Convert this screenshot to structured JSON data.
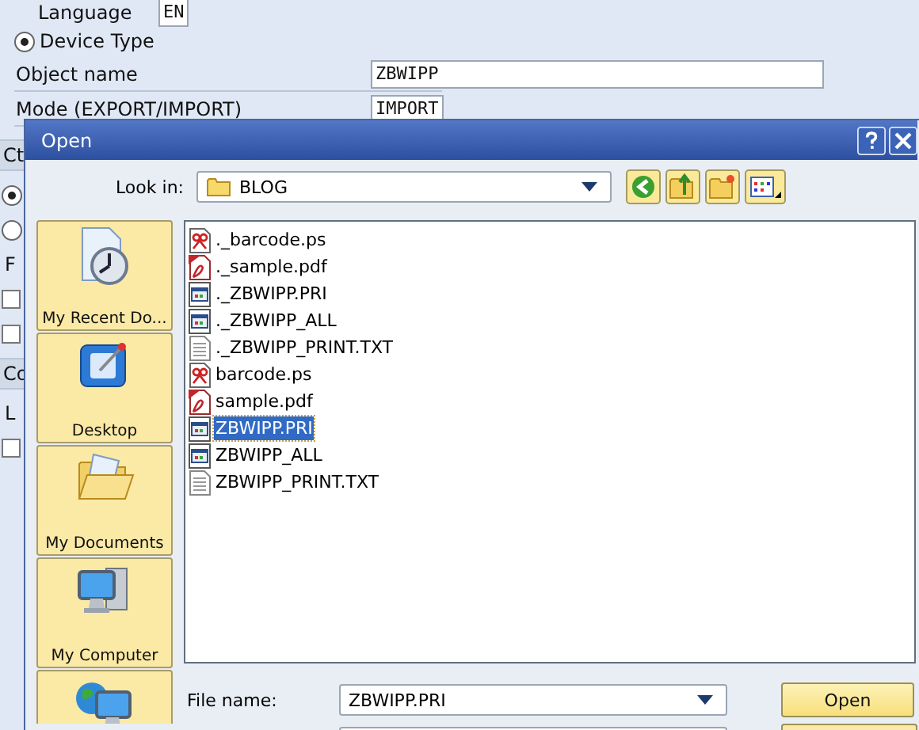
{
  "background_form": {
    "language": {
      "label": "Language",
      "value": "EN"
    },
    "device_type": {
      "label": "Device Type",
      "selected": true
    },
    "object_name": {
      "label": "Object name",
      "value": "ZBWIPP"
    },
    "mode": {
      "label": "Mode (EXPORT/IMPORT)",
      "value": "IMPORT"
    },
    "left_fragments": [
      {
        "kind": "tab",
        "text": "Ct"
      },
      {
        "kind": "radio",
        "selected": true
      },
      {
        "kind": "radio",
        "selected": false
      },
      {
        "kind": "text",
        "text": "F"
      },
      {
        "kind": "checkbox",
        "checked": false
      },
      {
        "kind": "checkbox",
        "checked": false
      },
      {
        "kind": "tab",
        "text": "Co"
      },
      {
        "kind": "text",
        "text": "L"
      },
      {
        "kind": "checkbox",
        "checked": false
      }
    ]
  },
  "dialog": {
    "title": "Open",
    "look_in": {
      "label": "Look in:",
      "value": "BLOG"
    },
    "places": [
      {
        "kind": "recent",
        "label": "My Recent Do..."
      },
      {
        "kind": "desktop",
        "label": "Desktop"
      },
      {
        "kind": "documents",
        "label": "My Documents"
      },
      {
        "kind": "computer",
        "label": "My Computer"
      },
      {
        "kind": "network"
      }
    ],
    "files": [
      {
        "kind": "ps",
        "name": "._barcode.ps",
        "selected": false
      },
      {
        "kind": "pdf",
        "name": "._sample.pdf",
        "selected": false
      },
      {
        "kind": "pri",
        "name": "._ZBWIPP.PRI",
        "selected": false
      },
      {
        "kind": "pri",
        "name": "._ZBWIPP_ALL",
        "selected": false
      },
      {
        "kind": "txt",
        "name": "._ZBWIPP_PRINT.TXT",
        "selected": false
      },
      {
        "kind": "ps",
        "name": "barcode.ps",
        "selected": false
      },
      {
        "kind": "pdf",
        "name": "sample.pdf",
        "selected": false
      },
      {
        "kind": "pri",
        "name": "ZBWIPP.PRI",
        "selected": true
      },
      {
        "kind": "pri",
        "name": "ZBWIPP_ALL",
        "selected": false
      },
      {
        "kind": "txt",
        "name": "ZBWIPP_PRINT.TXT",
        "selected": false
      }
    ],
    "file_name": {
      "label": "File name:",
      "value": "ZBWIPP.PRI"
    },
    "open_button": "Open"
  }
}
